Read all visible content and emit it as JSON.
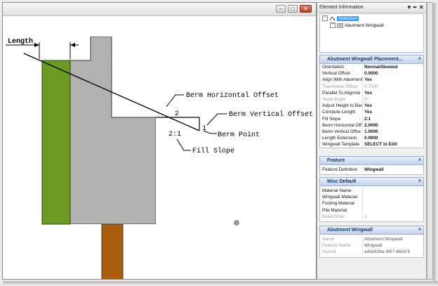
{
  "view": {
    "labels": {
      "length": "Length",
      "berm_horizontal_offset": "Berm Horizontal Offset",
      "berm_vertical_offset": "Berm Vertical Offset",
      "berm_point": "Berm Point",
      "fill_slope": "Fill Slope",
      "dim_2": "2",
      "dim_1": "1",
      "slope_ratio": "2:1"
    },
    "colors": {
      "green": "#6a9a1f",
      "concrete": "#b9b9b9",
      "pile": "#a85e0d"
    }
  },
  "panel": {
    "title": "Element Information",
    "tree": {
      "root": "Selection",
      "child": "Abutment Wingwall"
    },
    "sections": [
      {
        "title": "Abutment Wingwall Placement...",
        "rows": [
          {
            "name": "Orientation",
            "value": "Normal/Skewed"
          },
          {
            "name": "Vertical Offset",
            "value": "0.0000"
          },
          {
            "name": "Align With Abutment",
            "value": "Yes"
          },
          {
            "name": "Transverse Offset",
            "value": "0.7500"
          },
          {
            "name": "Parallel To Alignme",
            "value": "Yes"
          },
          {
            "name": "Skew Angle",
            "value": "0°"
          },
          {
            "name": "Adjust Height to Bac",
            "value": "Yes"
          },
          {
            "name": "Compute Length",
            "value": "Yes"
          },
          {
            "name": "Fill Slope",
            "value": "2:1"
          },
          {
            "name": "Berm Horizontal Off",
            "value": "2.0000"
          },
          {
            "name": "Berm Vertical Offse",
            "value": "1.0000"
          },
          {
            "name": "Length Extension",
            "value": "0.0000"
          },
          {
            "name": "Wingwall Template",
            "value": "SELECT to Edit"
          }
        ]
      },
      {
        "title": "Feature",
        "rows": [
          {
            "name": "Feature Definition",
            "value": "Wingwall"
          }
        ]
      },
      {
        "title": "Misc Default",
        "rows": [
          {
            "name": "Material Name",
            "value": ""
          },
          {
            "name": "Wingwall Material",
            "value": ""
          },
          {
            "name": "Footing Material",
            "value": ""
          },
          {
            "name": "Pile Material",
            "value": ""
          },
          {
            "name": "Build Order",
            "value": "1"
          }
        ]
      },
      {
        "title": "Abutment Wingwall",
        "rows": [
          {
            "name": "Name",
            "value": "Abutment Wingwall"
          },
          {
            "name": "Feature Name",
            "value": "Wingwall"
          },
          {
            "name": "SyncId",
            "value": "a4be83ba-9f87-46b3-9"
          }
        ]
      }
    ]
  }
}
